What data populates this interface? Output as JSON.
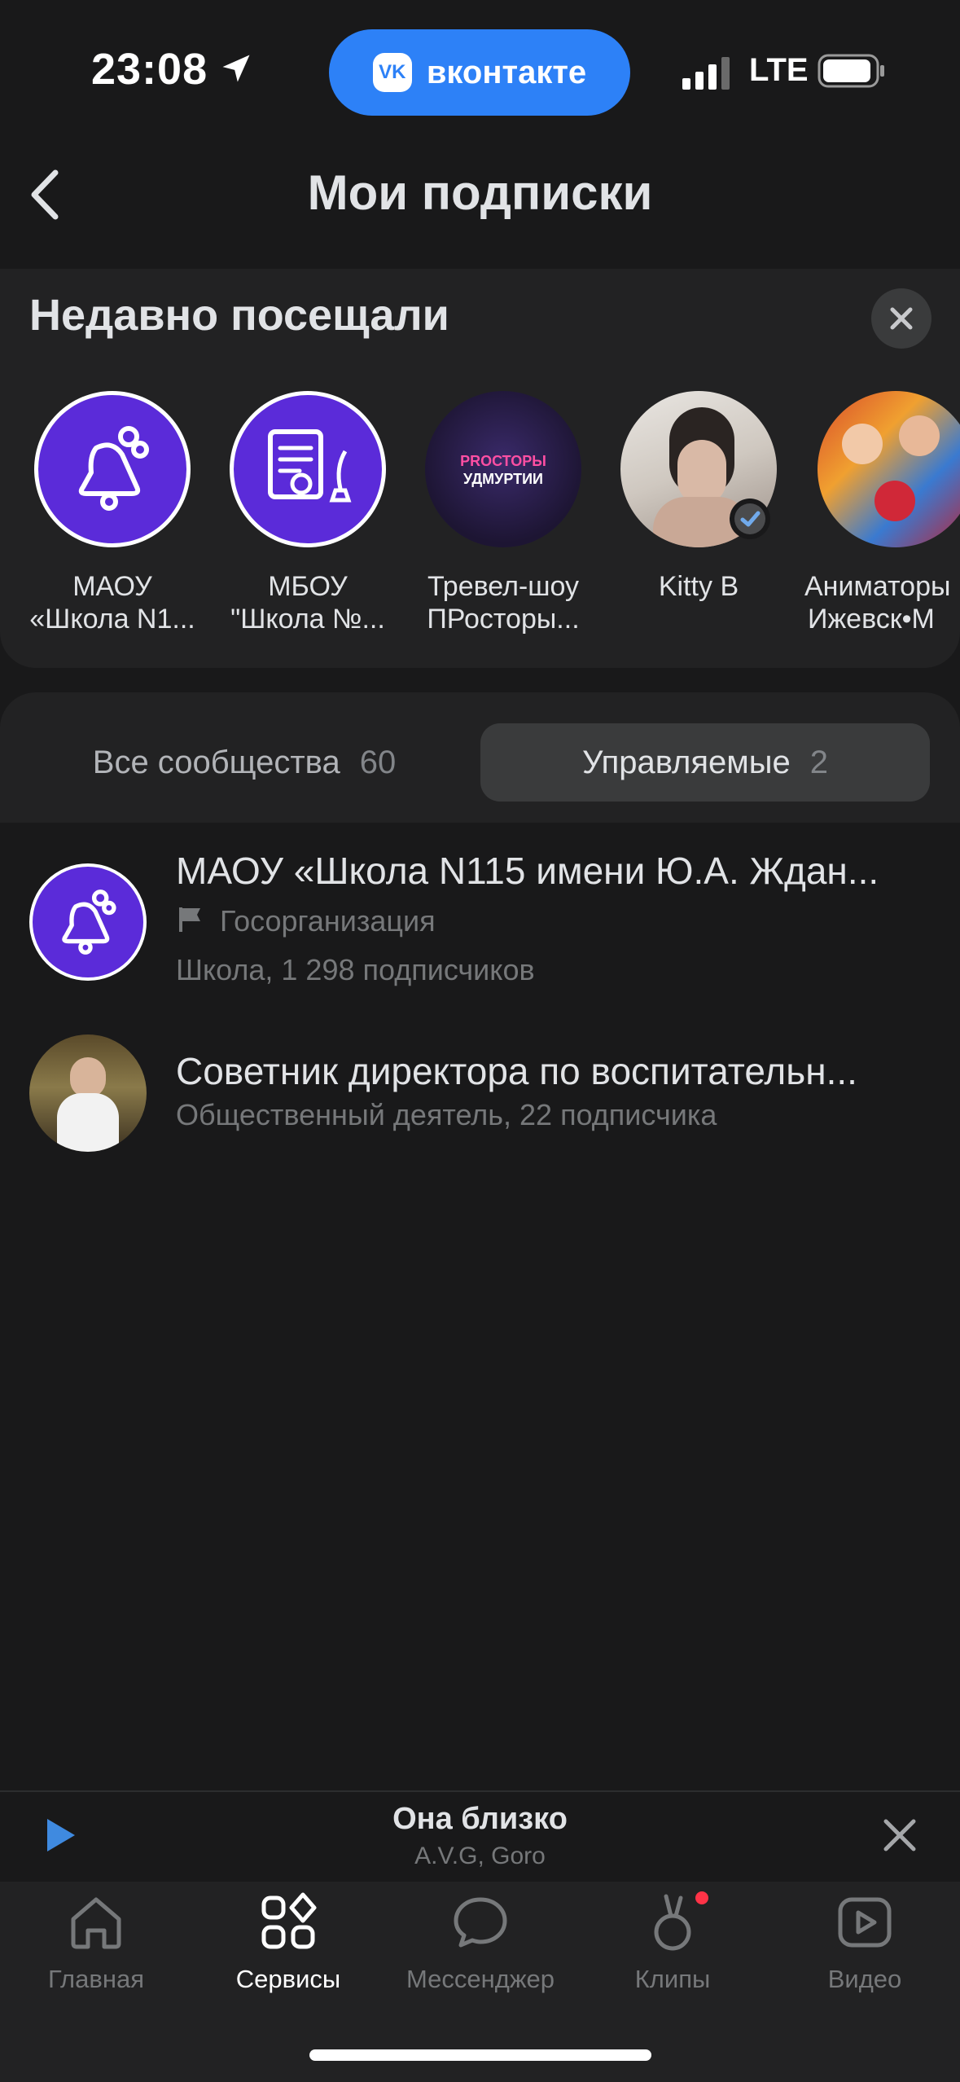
{
  "status_bar": {
    "time": "23:08",
    "network": "LTE",
    "app_pill": "вконтакте",
    "app_logo": "VK"
  },
  "header": {
    "title": "Мои подписки"
  },
  "recent": {
    "title": "Недавно посещали",
    "items": [
      {
        "line1": "МАОУ",
        "line2": "«Школа N1...",
        "avatar": "bell-icon"
      },
      {
        "line1": "МБОУ",
        "line2": "\"Школа №...",
        "avatar": "certificate-icon"
      },
      {
        "line1": "Тревел-шоу",
        "line2": "ПРосторы...",
        "avatar_text_1": "PROСТОРЫ",
        "avatar_text_2": "УДМУРТИИ"
      },
      {
        "line1": "Kitty B",
        "line2": "",
        "verified": true
      },
      {
        "line1": "Аниматоры",
        "line2": "Ижевск•М"
      }
    ]
  },
  "tabs": {
    "all": {
      "label": "Все сообщества",
      "count": "60"
    },
    "managed": {
      "label": "Управляемые",
      "count": "2"
    }
  },
  "communities": [
    {
      "title": "МАОУ «Школа N115 имени Ю.А. Ждан...",
      "tag": "Госорганизация",
      "subtitle": "Школа, 1 298 подписчиков"
    },
    {
      "title": "Советник директора по воспитательн...",
      "subtitle": "Общественный деятель, 22 подписчика"
    }
  ],
  "player": {
    "track": "Она близко",
    "artist": "A.V.G, Goro"
  },
  "nav": [
    {
      "label": "Главная",
      "icon": "home-icon"
    },
    {
      "label": "Сервисы",
      "icon": "services-icon"
    },
    {
      "label": "Мессенджер",
      "icon": "messenger-icon"
    },
    {
      "label": "Клипы",
      "icon": "clips-icon"
    },
    {
      "label": "Видео",
      "icon": "video-icon"
    }
  ],
  "colors": {
    "accent": "#2d81f7",
    "community_purple": "#5b2bd9",
    "background": "#19191a",
    "card": "#222223",
    "badge": "#ff3347"
  }
}
